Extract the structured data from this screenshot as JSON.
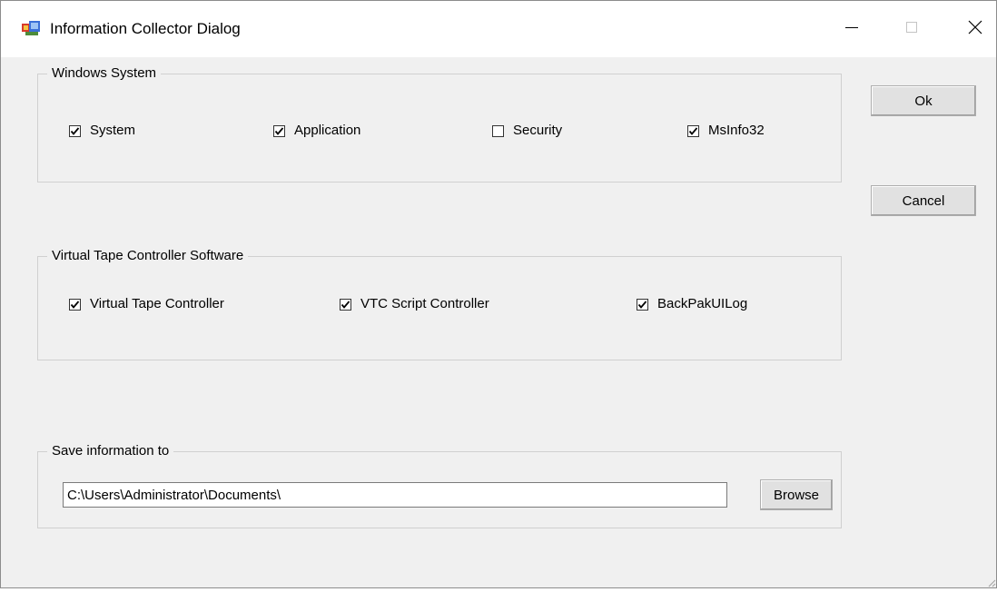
{
  "window": {
    "title": "Information Collector Dialog"
  },
  "windows_system": {
    "legend": "Windows System",
    "items": [
      {
        "label": "System",
        "checked": true
      },
      {
        "label": "Application",
        "checked": true
      },
      {
        "label": "Security",
        "checked": false
      },
      {
        "label": "MsInfo32",
        "checked": true
      }
    ]
  },
  "vtc_software": {
    "legend": "Virtual Tape Controller Software",
    "items": [
      {
        "label": "Virtual Tape Controller",
        "checked": true
      },
      {
        "label": "VTC Script Controller",
        "checked": true
      },
      {
        "label": "BackPakUILog",
        "checked": true
      }
    ]
  },
  "save": {
    "legend": "Save information to",
    "path": "C:\\Users\\Administrator\\Documents\\",
    "browse_label": "Browse"
  },
  "buttons": {
    "ok_label": "Ok",
    "cancel_label": "Cancel"
  }
}
